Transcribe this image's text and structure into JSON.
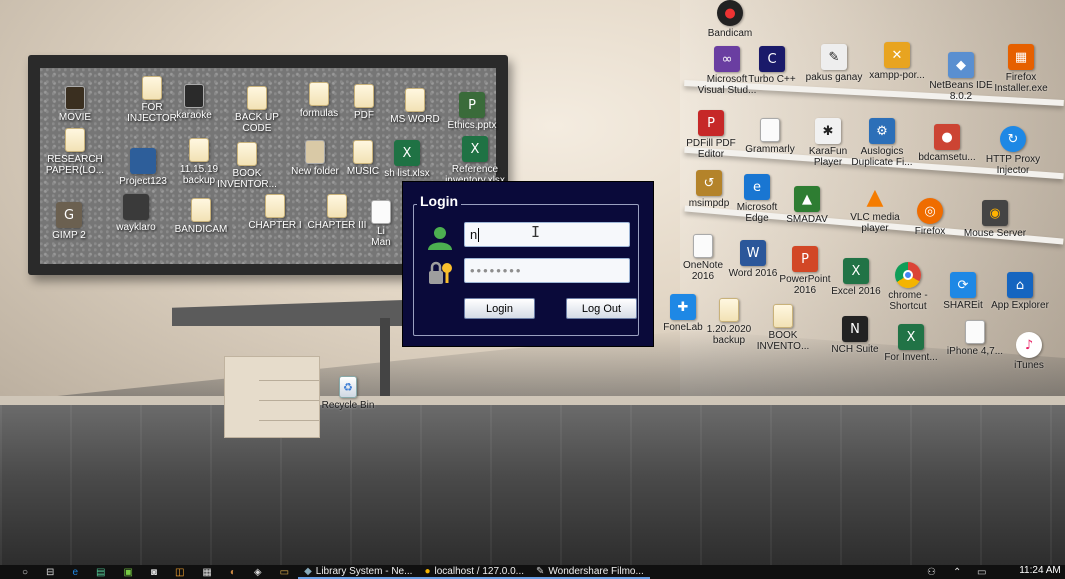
{
  "login_dialog": {
    "title": "Login",
    "username_value": "n",
    "password_mask": "••••••••",
    "login_button": "Login",
    "logout_button": "Log Out"
  },
  "desktop_left": [
    {
      "label": "MOVIE",
      "icon": "movie-folder-icon"
    },
    {
      "label": "FOR\nINJECTOR",
      "icon": "folder-icon"
    },
    {
      "label": "karaoke",
      "icon": "folder-icon"
    },
    {
      "label": "BACK UP\nCODE",
      "icon": "folder-icon"
    },
    {
      "label": "formulas",
      "icon": "folder-icon"
    },
    {
      "label": "PDF",
      "icon": "folder-icon"
    },
    {
      "label": "MS WORD",
      "icon": "folder-icon"
    },
    {
      "label": "Ethics.pptx",
      "icon": "pptx-file-icon"
    },
    {
      "label": "RESEARCH\nPAPER(LO...",
      "icon": "folder-icon"
    },
    {
      "label": "Project123",
      "icon": "folder-icon"
    },
    {
      "label": "11.15.19\nbackup",
      "icon": "folder-icon"
    },
    {
      "label": "BOOK\nINVENTOR...",
      "icon": "folder-icon"
    },
    {
      "label": "New folder",
      "icon": "folder-icon"
    },
    {
      "label": "MUSIC",
      "icon": "folder-icon"
    },
    {
      "label": "sh list.xlsx",
      "icon": "xlsx-file-icon"
    },
    {
      "label": "Reference\ninventory.xlsx",
      "icon": "xlsx-file-icon"
    },
    {
      "label": "GIMP 2",
      "icon": "gimp-icon"
    },
    {
      "label": "wayklaro",
      "icon": "folder-icon"
    },
    {
      "label": "BANDICAM",
      "icon": "folder-icon"
    },
    {
      "label": "CHAPTER I",
      "icon": "folder-icon"
    },
    {
      "label": "CHAPTER III",
      "icon": "folder-icon"
    },
    {
      "label": "Li\nMan",
      "icon": "file-icon"
    },
    {
      "label": "Recycle Bin",
      "icon": "recycle-bin-icon"
    }
  ],
  "desktop_right": [
    {
      "label": "Bandicam",
      "icon": "bandicam-icon"
    },
    {
      "label": "Microsoft\nVisual Stud...",
      "icon": "visual-studio-icon"
    },
    {
      "label": "Turbo C++",
      "icon": "turbo-cpp-icon"
    },
    {
      "label": "pakus ganay",
      "icon": "shortcut-icon"
    },
    {
      "label": "xampp-por...",
      "icon": "xampp-icon"
    },
    {
      "label": "NetBeans IDE\n8.0.2",
      "icon": "netbeans-icon"
    },
    {
      "label": "Firefox\nInstaller.exe",
      "icon": "firefox-installer-icon"
    },
    {
      "label": "PDFill PDF\nEditor",
      "icon": "pdfill-icon"
    },
    {
      "label": "Grammarly",
      "icon": "grammarly-icon"
    },
    {
      "label": "KaraFun\nPlayer",
      "icon": "karafun-icon"
    },
    {
      "label": "Auslogics\nDuplicate Fi...",
      "icon": "auslogics-icon"
    },
    {
      "label": "bdcamsetu...",
      "icon": "bandicam-setup-icon"
    },
    {
      "label": "HTTP Proxy\nInjector",
      "icon": "http-proxy-icon"
    },
    {
      "label": "msimpdp",
      "icon": "msimpdp-icon"
    },
    {
      "label": "Microsoft\nEdge",
      "icon": "edge-icon"
    },
    {
      "label": "SMADAV",
      "icon": "smadav-icon"
    },
    {
      "label": "VLC media\nplayer",
      "icon": "vlc-icon"
    },
    {
      "label": "Firefox",
      "icon": "firefox-icon"
    },
    {
      "label": "Mouse Server",
      "icon": "mouse-server-icon"
    },
    {
      "label": "OneNote\n2016",
      "icon": "onenote-icon"
    },
    {
      "label": "Word 2016",
      "icon": "word-icon"
    },
    {
      "label": "PowerPoint\n2016",
      "icon": "powerpoint-icon"
    },
    {
      "label": "Excel 2016",
      "icon": "excel-icon"
    },
    {
      "label": "chrome -\nShortcut",
      "icon": "chrome-icon"
    },
    {
      "label": "SHAREit",
      "icon": "shareit-icon"
    },
    {
      "label": "App Explorer",
      "icon": "app-explorer-icon"
    },
    {
      "label": "FoneLab",
      "icon": "fonelab-icon"
    },
    {
      "label": "1.20.2020\nbackup",
      "icon": "folder-icon"
    },
    {
      "label": "BOOK\nINVENTO...",
      "icon": "folder-icon"
    },
    {
      "label": "NCH Suite",
      "icon": "nch-icon"
    },
    {
      "label": "For Invent...",
      "icon": "xlsx-file-icon"
    },
    {
      "label": "iPhone 4,7...",
      "icon": "iphone-icon"
    },
    {
      "label": "iTunes",
      "icon": "itunes-icon"
    }
  ],
  "taskbar": {
    "apps": [
      {
        "label": "Library System - Ne...",
        "icon": "java-app-icon"
      },
      {
        "label": "localhost / 127.0.0...",
        "icon": "chrome-icon"
      },
      {
        "label": "Wondershare Filmo...",
        "icon": "filmora-icon"
      }
    ],
    "clock_time": "11:24 AM"
  }
}
